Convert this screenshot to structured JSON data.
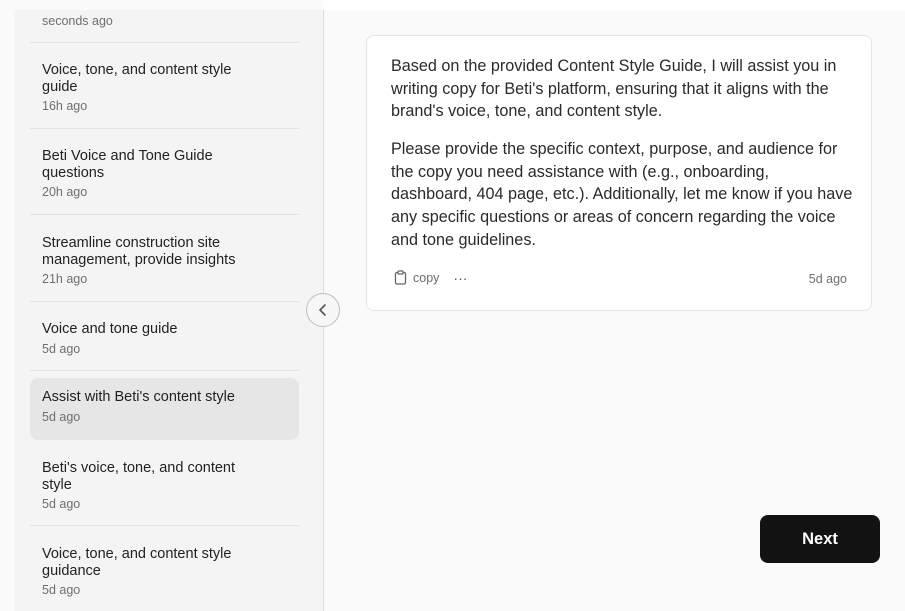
{
  "sidebar": {
    "items": [
      {
        "title": "",
        "time": "seconds ago"
      },
      {
        "title": "Voice, tone, and content style guide",
        "time": "16h ago"
      },
      {
        "title": "Beti Voice and Tone Guide questions",
        "time": "20h ago"
      },
      {
        "title": "Streamline construction site management, provide insights",
        "time": "21h ago"
      },
      {
        "title": "Voice and tone guide",
        "time": "5d ago"
      },
      {
        "title": "Assist with Beti's content style",
        "time": "5d ago"
      },
      {
        "title": "Beti's voice, tone, and content style",
        "time": "5d ago"
      },
      {
        "title": "Voice, tone, and content style guidance",
        "time": "5d ago"
      }
    ]
  },
  "message": {
    "paragraph_1": "Based on the provided Content Style Guide, I will assist you in writing copy for Beti's platform, ensuring that it aligns with the brand's voice, tone, and content style.",
    "paragraph_2": "Please provide the specific context, purpose, and audience for the copy you need assistance with (e.g., onboarding, dashboard, 404 page, etc.). Additionally, let me know if you have any specific questions or areas of concern regarding the voice and tone guidelines.",
    "copy_label": "copy",
    "more_label": "···",
    "time": "5d ago"
  },
  "next_button": {
    "label": "Next"
  },
  "icons": {
    "collapse": "chevron-left-icon",
    "copy": "clipboard-icon",
    "more": "ellipsis-icon"
  },
  "colors": {
    "next_button_bg": "#121212",
    "selected_item_bg": "#e6e6e6",
    "sidebar_bg": "#f4f4f4"
  }
}
